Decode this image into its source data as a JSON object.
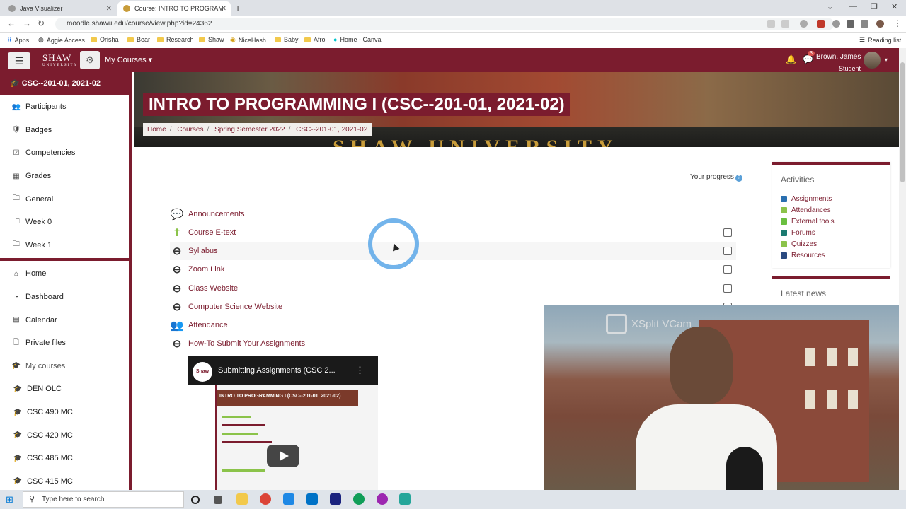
{
  "browser": {
    "tabs": [
      {
        "title": "Java Visualizer",
        "close": "✕"
      },
      {
        "title": "Course: INTRO TO PROGRAMMI...",
        "close": "✕"
      }
    ],
    "new_tab": "+",
    "url": "moodle.shawu.edu/course/view.php?id=24362",
    "bookmarks": [
      "Apps",
      "Aggie Access",
      "Orisha",
      "Bear",
      "Research",
      "Shaw",
      "NiceHash",
      "Baby",
      "Afro",
      "Home - Canva"
    ],
    "reading_list": "Reading list"
  },
  "navbar": {
    "logo": "SHAW",
    "logo_sub": "UNIVERSITY",
    "my_courses": "My Courses",
    "notification_count": "3",
    "user_name": "Brown, James",
    "user_role": "Student"
  },
  "sidebar": {
    "course": "CSC--201-01, 2021-02",
    "section1": [
      {
        "label": "Participants",
        "icon": "users-icon",
        "glyph": "👥"
      },
      {
        "label": "Badges",
        "icon": "shield-icon",
        "glyph": "🛡"
      },
      {
        "label": "Competencies",
        "icon": "check-square-icon",
        "glyph": "☑"
      },
      {
        "label": "Grades",
        "icon": "table-icon",
        "glyph": "▦"
      },
      {
        "label": "General",
        "icon": "folder-icon",
        "glyph": "🗀"
      },
      {
        "label": "Week 0",
        "icon": "folder-icon",
        "glyph": "🗀"
      },
      {
        "label": "Week 1",
        "icon": "folder-icon",
        "glyph": "🗀"
      }
    ],
    "section2": [
      {
        "label": "Home",
        "icon": "home-icon",
        "glyph": "⌂"
      },
      {
        "label": "Dashboard",
        "icon": "dashboard-icon",
        "glyph": "◔"
      },
      {
        "label": "Calendar",
        "icon": "calendar-icon",
        "glyph": "▤"
      },
      {
        "label": "Private files",
        "icon": "file-icon",
        "glyph": "🗋"
      },
      {
        "label": "My courses",
        "icon": "graduation-cap-icon",
        "glyph": "🎓"
      },
      {
        "label": "DEN OLC",
        "icon": "graduation-cap-icon",
        "glyph": "🎓"
      },
      {
        "label": "CSC 490 MC",
        "icon": "graduation-cap-icon",
        "glyph": "🎓"
      },
      {
        "label": "CSC 420 MC",
        "icon": "graduation-cap-icon",
        "glyph": "🎓"
      },
      {
        "label": "CSC 485 MC",
        "icon": "graduation-cap-icon",
        "glyph": "🎓"
      },
      {
        "label": "CSC 415 MC",
        "icon": "graduation-cap-icon",
        "glyph": "🎓"
      }
    ]
  },
  "banner": {
    "heading": "INTRO TO PROGRAMMING I (CSC--201-01, 2021-02)",
    "banner_text": "SHAW UNIVERSITY",
    "breadcrumb": [
      "Home",
      "Courses",
      "Spring Semester 2022",
      "CSC--201-01, 2021-02"
    ],
    "breadcrumb_sep": "/"
  },
  "main": {
    "progress_label": "Your progress",
    "progress_help": "?",
    "activities": [
      {
        "label": "Announcements",
        "icon": "forum-icon",
        "glyph": "💬",
        "color": "#1b7a70",
        "checkbox": false
      },
      {
        "label": "Course E-text",
        "icon": "upload-icon",
        "glyph": "⬆",
        "color": "#8bc34a",
        "checkbox": true
      },
      {
        "label": "Syllabus",
        "icon": "link-icon",
        "glyph": "⊖",
        "color": "#333333",
        "checkbox": true
      },
      {
        "label": "Zoom Link",
        "icon": "link-icon",
        "glyph": "⊖",
        "color": "#333333",
        "checkbox": true
      },
      {
        "label": "Class Website",
        "icon": "link-icon",
        "glyph": "⊖",
        "color": "#333333",
        "checkbox": true
      },
      {
        "label": "Computer Science Website",
        "icon": "link-icon",
        "glyph": "⊖",
        "color": "#333333",
        "checkbox": true
      },
      {
        "label": "Attendance",
        "icon": "attendance-icon",
        "glyph": "👥",
        "color": "#8bc34a",
        "checkbox": false
      },
      {
        "label": "How-To Submit Your Assignments",
        "icon": "link-icon",
        "glyph": "⊖",
        "color": "#333333",
        "checkbox": false
      }
    ],
    "video": {
      "title": "Submitting Assignments (CSC 2...",
      "channel": "Shaw",
      "thumb_heading": "INTRO TO PROGRAMMING I (CSC--201-01, 2021-02)",
      "menu": "⋮"
    }
  },
  "blocks": {
    "activities_title": "Activities",
    "activities": [
      {
        "label": "Assignments",
        "color": "#2a6fb0"
      },
      {
        "label": "Attendances",
        "color": "#8bc34a"
      },
      {
        "label": "External tools",
        "color": "#6abf40"
      },
      {
        "label": "Forums",
        "color": "#1b7a70"
      },
      {
        "label": "Quizzes",
        "color": "#8bc34a"
      },
      {
        "label": "Resources",
        "color": "#2a4a80"
      }
    ],
    "news_title": "Latest news"
  },
  "webcam": {
    "overlay": "XSplit VCam"
  },
  "taskbar": {
    "search_placeholder": "Type here to search"
  },
  "colors": {
    "brand": "#7b1c2e",
    "link": "#7b1c2e",
    "accent": "#5aa7e8"
  }
}
